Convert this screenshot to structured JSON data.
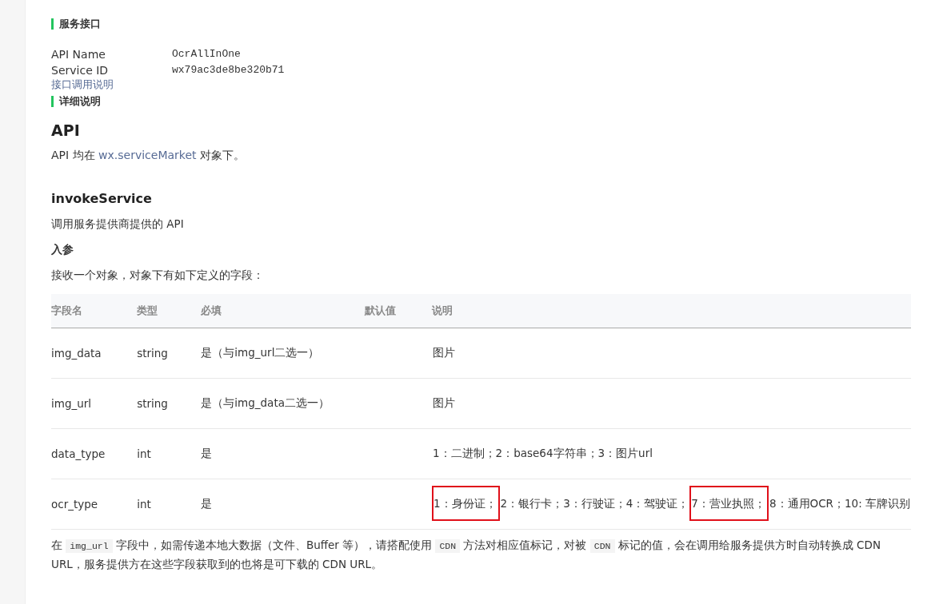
{
  "service_heading": "服务接口",
  "info": [
    {
      "label": "API Name",
      "value": "OcrAllInOne"
    },
    {
      "label": "Service ID",
      "value": "wx79ac3de8be320b71"
    }
  ],
  "doc_link": "接口调用说明",
  "detail_heading": "详细说明",
  "api_title": "API",
  "api_desc": {
    "before": "API 均在 ",
    "link": "wx.serviceMarket",
    "after": " 对象下。"
  },
  "method_title": "invokeService",
  "method_desc": "调用服务提供商提供的 API",
  "params_title": "入参",
  "params_desc": "接收一个对象，对象下有如下定义的字段：",
  "table": {
    "columns": [
      "字段名",
      "类型",
      "必填",
      "默认值",
      "说明"
    ],
    "rows": [
      {
        "name": "img_data",
        "type": "string",
        "required": "是（与img_url二选一）",
        "description": [
          {
            "text": "图片",
            "highlighted": false
          }
        ]
      },
      {
        "name": "img_url",
        "type": "string",
        "required": "是（与img_data二选一）",
        "description": [
          {
            "text": "图片",
            "highlighted": false
          }
        ]
      },
      {
        "name": "data_type",
        "type": "int",
        "required": "是",
        "description": [
          {
            "text": "1：二进制；2：base64字符串；3：图片url",
            "highlighted": false
          }
        ]
      },
      {
        "name": "ocr_type",
        "type": "int",
        "required": "是",
        "description": [
          {
            "text": "1：身份证；",
            "highlighted": true
          },
          {
            "text": "2：银行卡；3：行驶证；4：驾驶证；",
            "highlighted": false
          },
          {
            "text": "7：营业执照；",
            "highlighted": true
          },
          {
            "text": "8：通用OCR；10: 车牌识别",
            "highlighted": false
          }
        ]
      }
    ]
  },
  "note": [
    {
      "kind": "text",
      "text": "在 "
    },
    {
      "kind": "code",
      "text": "img_url"
    },
    {
      "kind": "text",
      "text": " 字段中，如需传递本地大数据（文件、Buffer 等），请搭配使用 "
    },
    {
      "kind": "code",
      "text": "CDN"
    },
    {
      "kind": "text",
      "text": " 方法对相应值标记，对被 "
    },
    {
      "kind": "code",
      "text": "CDN"
    },
    {
      "kind": "text",
      "text": " 标记的值，会在调用给服务提供方时自动转换成 CDN URL，服务提供方在这些字段获取到的也将是可下载的 CDN URL。"
    }
  ]
}
